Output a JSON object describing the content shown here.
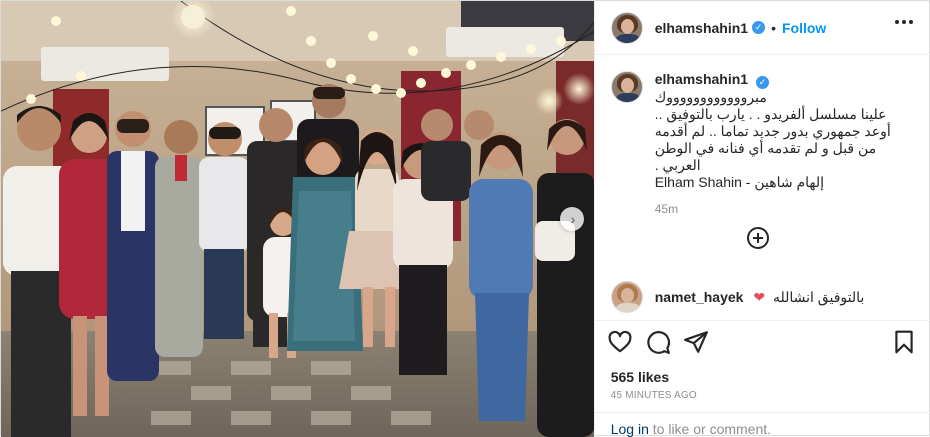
{
  "post": {
    "username": "elhamshahin1",
    "verified_mark": "✓",
    "separator": "•",
    "follow_label": "Follow",
    "more_icon": "more-options-icon",
    "caption": {
      "username": "elhamshahin1",
      "lines": [
        "مبرووووووووووووك",
        "علينا مسلسل ألفريدو . . يارب بالتوفيق ..",
        "أوعد جمهوري بدور جديد تماما .. لم أقدمه",
        "من قبل و لم تقدمه أي فنانه في الوطن",
        "العربي .",
        "Elham Shahin - إلهام شاهين"
      ],
      "time": "45m"
    },
    "comment": {
      "username": "namet_hayek",
      "text": "بالتوفيق انشالله",
      "heart": "❤"
    },
    "likes": "565 likes",
    "time_ago": "45 MINUTES AGO",
    "login": {
      "link": "Log in",
      "text": " to like or comment."
    },
    "next_arrow": "›",
    "icons": [
      "heart-icon",
      "comment-icon",
      "share-icon",
      "bookmark-icon",
      "load-more-icon"
    ],
    "colors": {
      "accent": "#0095f6",
      "verified": "#3897f0",
      "heart": "#ed4956",
      "secondary_text": "#8e8e8e",
      "link": "#00376b"
    }
  }
}
